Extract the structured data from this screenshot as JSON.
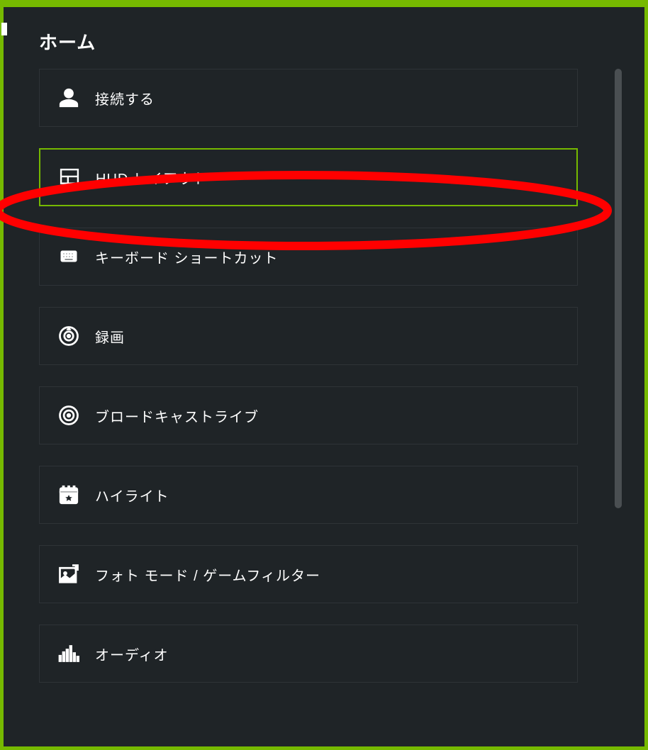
{
  "accentColor": "#76b900",
  "annotationColor": "#ff0000",
  "header": {
    "title": "ホーム"
  },
  "menu": {
    "items": [
      {
        "id": "connect",
        "icon": "person-icon",
        "label": "接続する",
        "selected": false
      },
      {
        "id": "hud",
        "icon": "layout-icon",
        "label": "HUD レイアウト",
        "selected": true
      },
      {
        "id": "keyboard",
        "icon": "keyboard-icon",
        "label": "キーボード ショートカット",
        "selected": false
      },
      {
        "id": "record",
        "icon": "record-icon",
        "label": "録画",
        "selected": false
      },
      {
        "id": "broadcast",
        "icon": "broadcast-icon",
        "label": "ブロードキャストライブ",
        "selected": false
      },
      {
        "id": "highlight",
        "icon": "highlight-icon",
        "label": "ハイライト",
        "selected": false
      },
      {
        "id": "photo",
        "icon": "photo-icon",
        "label": "フォト モード / ゲームフィルター",
        "selected": false
      },
      {
        "id": "audio",
        "icon": "audio-icon",
        "label": "オーディオ",
        "selected": false
      }
    ]
  }
}
